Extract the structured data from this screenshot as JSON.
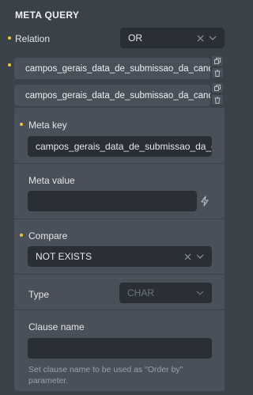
{
  "section": {
    "title": "META QUERY"
  },
  "relation": {
    "label": "Relation",
    "value": "OR"
  },
  "query_items": [
    {
      "label": "campos_gerais_data_de_submissao_da_candid..."
    },
    {
      "label": "campos_gerais_data_de_submissao_da_candid..."
    }
  ],
  "clause": {
    "meta_key": {
      "label": "Meta key",
      "value": "campos_gerais_data_de_submissao_da_candid"
    },
    "meta_value": {
      "label": "Meta value",
      "value": ""
    },
    "compare": {
      "label": "Compare",
      "value": "NOT EXISTS"
    },
    "type": {
      "label": "Type",
      "value": "CHAR"
    },
    "clause_name": {
      "label": "Clause name",
      "value": "",
      "help_line1": "Set clause name to be used as \"Order by\"",
      "help_line2": "parameter."
    }
  },
  "colors": {
    "accent_dot": "#f2c530",
    "background": "#3b4149",
    "panel": "#4a5059",
    "field": "#2a2f35"
  },
  "icons": [
    "close-icon",
    "chevron-down-icon",
    "copy-icon",
    "trash-icon",
    "dynamic-data-icon"
  ]
}
